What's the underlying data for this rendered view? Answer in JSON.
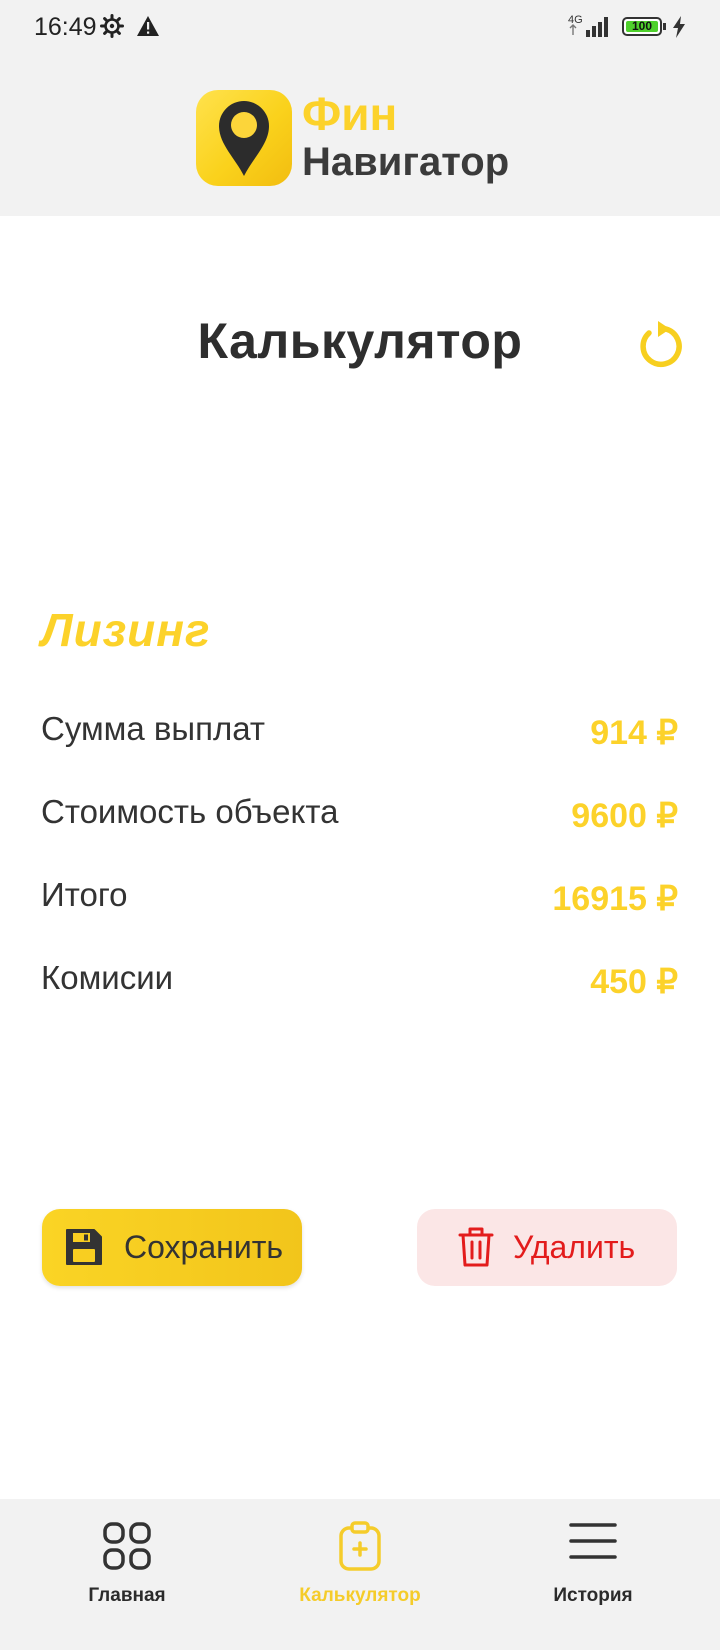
{
  "status_bar": {
    "time": "16:49",
    "network": "4G",
    "battery": "100",
    "icons": [
      "gear-icon",
      "alert-icon",
      "signal-icon",
      "battery-icon",
      "charging-icon"
    ]
  },
  "header": {
    "logo_word1": "Фин",
    "logo_word2": "Навигатор",
    "logo_icon": "map-pin-icon"
  },
  "page": {
    "title": "Калькулятор",
    "reset_icon": "refresh-icon"
  },
  "result": {
    "section_title": "Лизинг",
    "rows": [
      {
        "label": "Сумма выплат",
        "value": "914 ₽"
      },
      {
        "label": "Стоимость объекта",
        "value": "9600 ₽"
      },
      {
        "label": "Итого",
        "value": "16915 ₽"
      },
      {
        "label": "Комисии",
        "value": "450 ₽"
      }
    ]
  },
  "actions": {
    "save_label": "Сохранить",
    "save_icon": "floppy-disk-icon",
    "delete_label": "Удалить",
    "delete_icon": "trash-icon"
  },
  "bottom_nav": {
    "items": [
      {
        "label": "Главная",
        "icon": "grid-icon",
        "active": false
      },
      {
        "label": "Калькулятор",
        "icon": "clipboard-plus-icon",
        "active": true
      },
      {
        "label": "История",
        "icon": "menu-icon",
        "active": false
      }
    ]
  },
  "colors": {
    "accent": "#fcd22a",
    "dark_text": "#333333",
    "danger": "#e31c1c",
    "danger_bg": "#fbe6e6",
    "bar_bg": "#f2f2f2"
  }
}
